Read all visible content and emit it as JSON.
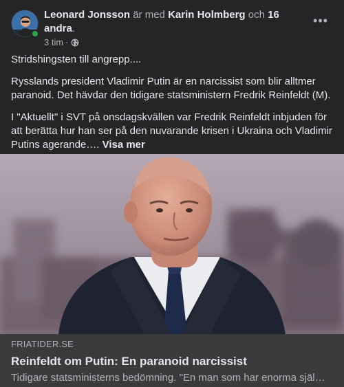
{
  "post": {
    "author": "Leonard Jonsson",
    "with_text": "är med",
    "tagged_person": "Karin Holmberg",
    "and_text": "och",
    "others_count": "16 andra",
    "period": ".",
    "timestamp": "3 tim",
    "separator": "·",
    "privacy_icon": "globe-icon",
    "more_label": "•••",
    "paragraphs": [
      "Stridshingsten till angrepp....",
      "Rysslands president Vladimir Putin är en narcissist som blir alltmer paranoid. Det hävdar den tidigare statsministern Fredrik Reinfeldt (M).",
      "I \"Aktuellt\" i SVT på onsdagskvällen var Fredrik Reinfeldt inbjuden för att berätta hur han ser på den nuvarande krisen i Ukraina och Vladimir Putins agerande…."
    ],
    "see_more": "Visa mer"
  },
  "link": {
    "domain": "FRIATIDER.SE",
    "title": "Reinfeldt om Putin: En paranoid narcissist",
    "description": "Tidigare statsministerns bedömning. \"En man som har enorma själ…"
  },
  "colors": {
    "background": "#242526",
    "link_background": "#3a3b3c",
    "primary_text": "#e4e6eb",
    "secondary_text": "#b0b3b8",
    "online": "#31a24c"
  }
}
